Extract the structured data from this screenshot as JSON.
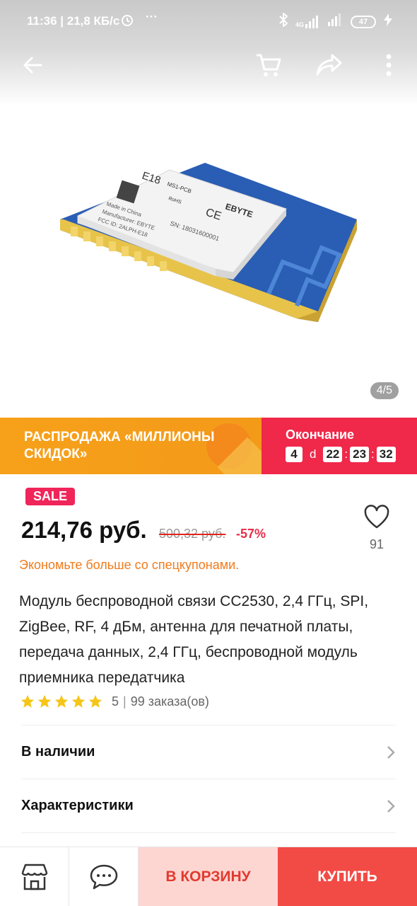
{
  "status_bar": {
    "time_speed": "11:36 | 21,8 КБ/с",
    "more": "···",
    "network": "4G",
    "battery": "47"
  },
  "top_nav": {
    "icons": [
      "back-arrow-icon",
      "cart-icon",
      "share-icon",
      "more-vertical-icon"
    ]
  },
  "gallery": {
    "counter": "4/5",
    "image_text": {
      "model": "E18",
      "model_sub": "MS1-PCB",
      "brand": "EBYTE",
      "made_in": "Made in China",
      "manufacturer": "Manufacturer: EBYTE",
      "fcc": "FCC ID: 2ALPH-E18",
      "sn": "SN: 18031600001",
      "rohs": "RoHS",
      "ce": "CE"
    }
  },
  "banner": {
    "title": "РАСПРОДАЖА «МИЛЛИОНЫ СКИДОК»",
    "ends_label": "Окончание",
    "days": "4",
    "days_unit": "d",
    "hours": "22",
    "minutes": "23",
    "seconds": "32",
    "colors": {
      "left": "#f7a11a",
      "right": "#f0284a"
    }
  },
  "price_block": {
    "badge": "SALE",
    "price": "214,76 руб.",
    "old_price": "500,32 руб.",
    "discount": "-57%",
    "wishlist_count": "91",
    "coupon_link": "Экономьте больше со спецкупонами."
  },
  "product": {
    "title": "Модуль беспроводной связи CC2530, 2,4 ГГц, SPI, ZigBee, RF, 4 дБм, антенна для печатной платы, передача данных, 2,4 ГГц, беспроводной модуль приемника передатчика",
    "rating": "5",
    "stars": 5,
    "orders": "99 заказа(ов)"
  },
  "rows": {
    "availability": "В наличии",
    "specs": "Характеристики"
  },
  "bottom_bar": {
    "store_icon": "store-icon",
    "chat_icon": "chat-icon",
    "add_to_cart": "В КОРЗИНУ",
    "buy": "КУПИТЬ",
    "colors": {
      "cart_bg": "#fdd6d2",
      "buy_bg": "#f24a45"
    }
  }
}
